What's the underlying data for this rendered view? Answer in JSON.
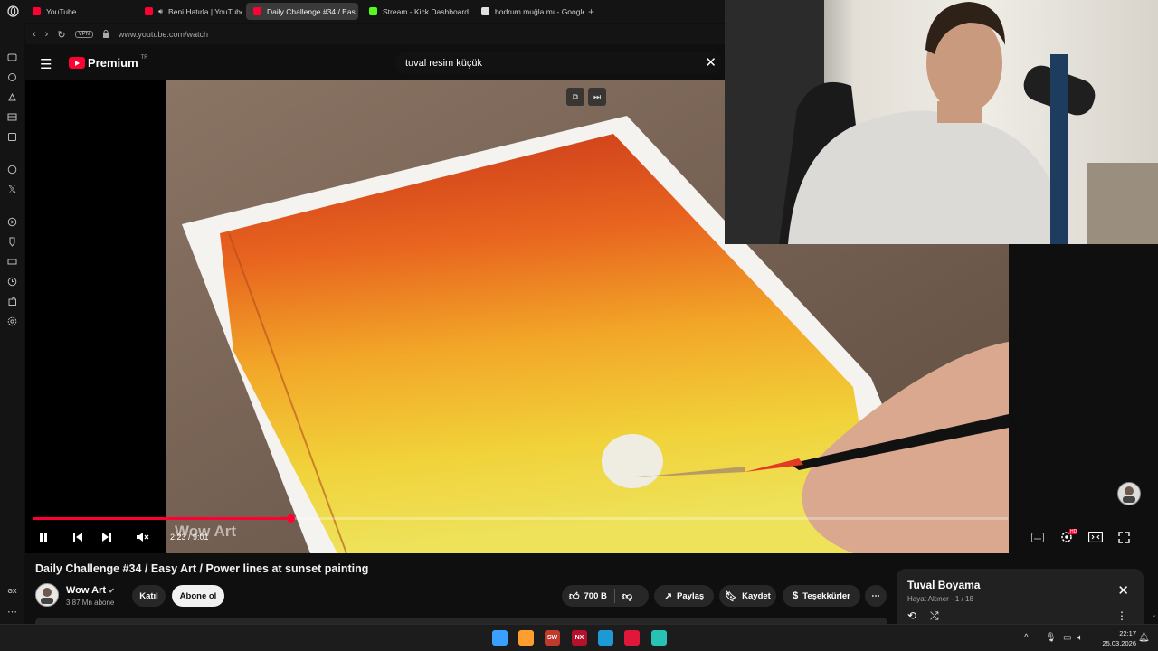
{
  "browser": {
    "tabs": [
      {
        "label": "YouTube",
        "color": "#ff0033",
        "active": false
      },
      {
        "label": "Beni Hatırla | YouTube",
        "color": "#ff0033",
        "active": false,
        "audio": true
      },
      {
        "label": "Daily Challenge #34 / Eas",
        "color": "#ff0033",
        "active": true
      },
      {
        "label": "Stream - Kick Dashboard",
        "color": "#53fc18",
        "active": false
      },
      {
        "label": "bodrum muğla mı - Google",
        "color": "#e0e0e0",
        "active": false
      }
    ],
    "vpn_label": "VPN",
    "url": "www.youtube.com/watch"
  },
  "sidebar": {
    "gx_label": "GX",
    "icons": [
      "messenger-icon",
      "refresh-icon",
      "flow-icon",
      "wallet-icon",
      "music-icon",
      "discord-icon",
      "x-icon",
      "play-icon",
      "lightbulb-icon",
      "hard-drive-icon",
      "history-icon",
      "extensions-icon",
      "settings-icon"
    ]
  },
  "youtube": {
    "logo_text": "Premium",
    "region": "TR",
    "search_value": "tuval resim küçük"
  },
  "player": {
    "current_time": "2:23",
    "duration": "9:01",
    "time_display": "2:23 / 9:01",
    "progress_fraction": 0.264,
    "watermark": "Wow Art",
    "hd_badge": "HD"
  },
  "video": {
    "title": "Daily Challenge #34 / Easy Art / Power lines at sunset painting",
    "channel": "Wow Art",
    "subscribers": "3,87 Mn abone",
    "join_label": "Katıl",
    "subscribe_label": "Abone ol",
    "like_count": "700 B",
    "share_label": "Paylaş",
    "save_label": "Kaydet",
    "thanks_label": "Teşekkürler"
  },
  "playlist": {
    "title": "Tuval Boyama",
    "subtitle": "Hayat Altıner - 1 / 18"
  },
  "taskbar": {
    "apps": [
      {
        "name": "windows-start-icon",
        "color": "#3aa0ff",
        "label": ""
      },
      {
        "name": "file-explorer-icon",
        "color": "#ff9d2e",
        "label": ""
      },
      {
        "name": "sw-2025-icon",
        "color": "#c0392b",
        "label": "SW"
      },
      {
        "name": "nx-icon",
        "color": "#b3122a",
        "label": "NX"
      },
      {
        "name": "edge-icon",
        "color": "#1d9ad6",
        "label": ""
      },
      {
        "name": "opera-gx-icon",
        "color": "#e0163a",
        "label": ""
      },
      {
        "name": "store-icon",
        "color": "#27c2b3",
        "label": ""
      }
    ],
    "time": "22:17",
    "date": "25.03.2026"
  }
}
